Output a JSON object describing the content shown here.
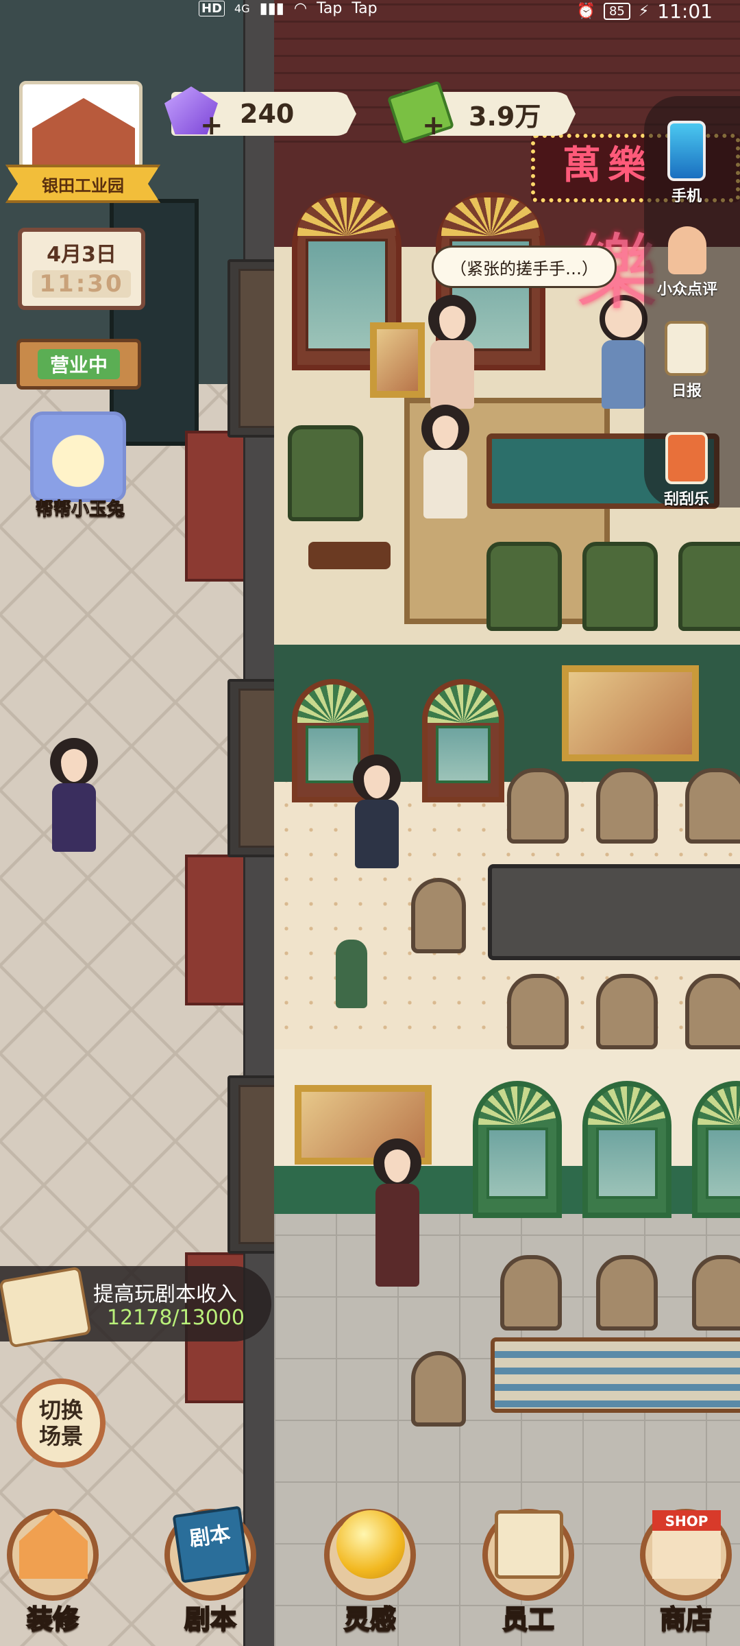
{
  "status_bar": {
    "hd": "HD",
    "network": "4G",
    "app1": "Tap",
    "app2": "Tap",
    "battery": "85",
    "time": "11:01"
  },
  "currencies": {
    "gems": "240",
    "cash": "3.9万"
  },
  "zone": {
    "name": "银田工业园"
  },
  "calendar": {
    "date": "4月3日",
    "time": "11:30"
  },
  "business_status": "营业中",
  "helper": {
    "label": "帮帮小玉兔"
  },
  "side_menu": [
    {
      "label": "手机",
      "icon": "phone-icon"
    },
    {
      "label": "小众点评",
      "icon": "thumbs-up-icon"
    },
    {
      "label": "日报",
      "icon": "clipboard-icon"
    },
    {
      "label": "刮刮乐",
      "icon": "scratch-card-icon"
    }
  ],
  "speech_bubble": "（紧张的搓手手…）",
  "neon_sign": "萬樂",
  "neon_big": "樂",
  "quest": {
    "title": "提高玩剧本收入",
    "progress": "12178/13000"
  },
  "switch_scene": {
    "line1": "切换",
    "line2": "场景"
  },
  "bottom_nav": [
    {
      "label": "装修",
      "icon": "house-icon"
    },
    {
      "label": "剧本",
      "icon": "script-book-icon",
      "badge": "剧本"
    },
    {
      "label": "灵感",
      "icon": "lightbulb-icon"
    },
    {
      "label": "员工",
      "icon": "staff-card-icon"
    },
    {
      "label": "商店",
      "icon": "shop-icon",
      "badge": "SHOP"
    }
  ]
}
